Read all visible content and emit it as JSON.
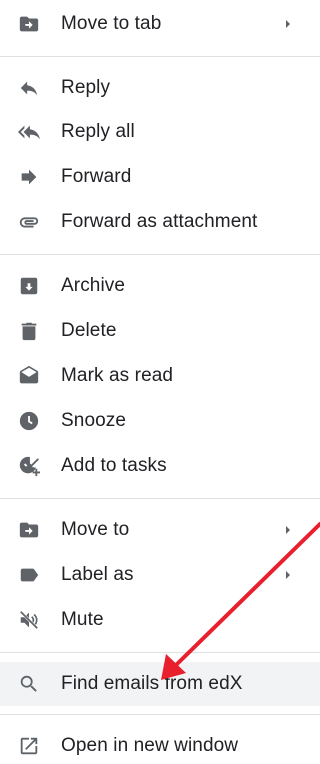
{
  "menu": {
    "items": [
      {
        "label": "Move to tab",
        "icon": "move-to-tab-icon",
        "submenu": true
      },
      {
        "label": "Reply",
        "icon": "reply-icon"
      },
      {
        "label": "Reply all",
        "icon": "reply-all-icon"
      },
      {
        "label": "Forward",
        "icon": "forward-icon"
      },
      {
        "label": "Forward as attachment",
        "icon": "attachment-icon"
      },
      {
        "label": "Archive",
        "icon": "archive-icon"
      },
      {
        "label": "Delete",
        "icon": "trash-icon"
      },
      {
        "label": "Mark as read",
        "icon": "open-envelope-icon"
      },
      {
        "label": "Snooze",
        "icon": "clock-icon"
      },
      {
        "label": "Add to tasks",
        "icon": "add-task-icon"
      },
      {
        "label": "Move to",
        "icon": "move-to-icon",
        "submenu": true
      },
      {
        "label": "Label as",
        "icon": "label-icon",
        "submenu": true
      },
      {
        "label": "Mute",
        "icon": "mute-icon"
      },
      {
        "label": "Find emails from edX",
        "icon": "search-icon",
        "highlighted": true
      },
      {
        "label": "Open in new window",
        "icon": "open-in-new-icon"
      }
    ]
  },
  "colors": {
    "text": "#202124",
    "icon": "#5f6368",
    "divider": "#e0e0e0",
    "highlight": "#f1f3f4",
    "annotation_arrow": "#e8202e"
  }
}
